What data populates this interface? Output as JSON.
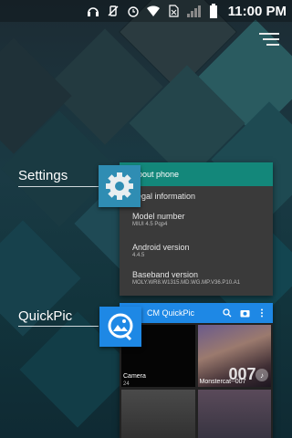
{
  "status_bar": {
    "time": "11:00",
    "ampm": "PM",
    "icons": [
      "headphones-icon",
      "vibrate-off-icon",
      "alarm-icon",
      "wifi-icon",
      "no-sim-icon",
      "signal-icon",
      "battery-icon"
    ]
  },
  "recents": [
    {
      "label": "Settings",
      "icon": "gear-icon",
      "preview": {
        "header": "About phone",
        "items": [
          {
            "title": "Legal information",
            "sub": ""
          },
          {
            "title": "Model number",
            "sub": "MIUI 4.5 Pqp4"
          },
          {
            "title": "Android version",
            "sub": "4.4.5"
          },
          {
            "title": "Baseband version",
            "sub": "MOLY.WR8.W1315.MD.WG.MP.V36.P10.A1"
          }
        ]
      }
    },
    {
      "label": "QuickPic",
      "icon": "quickpic-icon",
      "preview": {
        "title": "CM QuickPic",
        "albums": [
          {
            "name": "Camera",
            "count": "24"
          },
          {
            "name": "Monstercat--007",
            "count": ""
          }
        ]
      }
    }
  ],
  "colors": {
    "settings_accent": "#13877a",
    "settings_icon_bg": "#2f8db3",
    "quickpic_accent": "#1e88e5"
  }
}
